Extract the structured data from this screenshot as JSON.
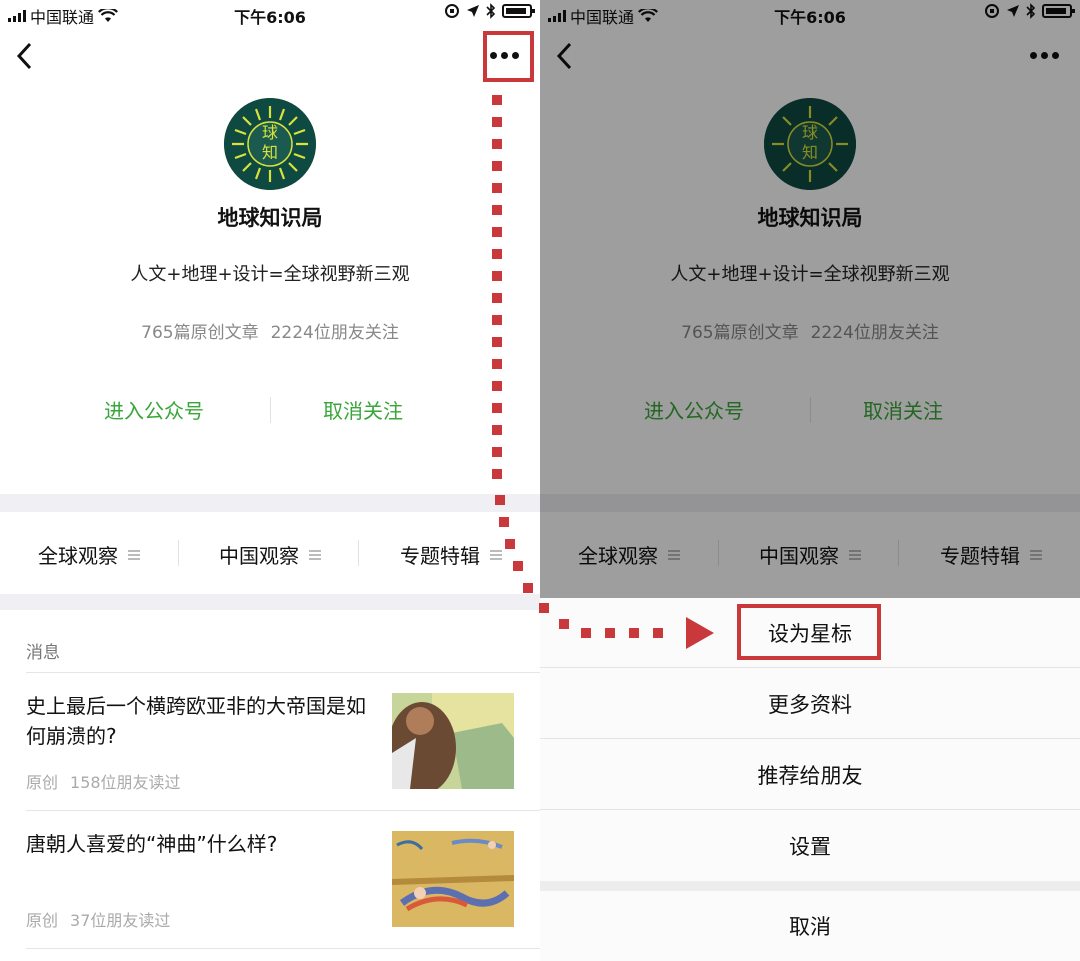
{
  "status_bar": {
    "carrier": "中国联通",
    "time": "下午6:06"
  },
  "profile": {
    "avatar_text": "球知",
    "name": "地球知识局",
    "description": "人文+地理+设计=全球视野新三观",
    "articles": "765篇原创文章",
    "followers": "2224位朋友关注",
    "enter_label": "进入公众号",
    "unfollow_label": "取消关注"
  },
  "menu": [
    {
      "label": "全球观察"
    },
    {
      "label": "中国观察"
    },
    {
      "label": "专题特辑"
    }
  ],
  "messages": {
    "header": "消息",
    "items": [
      {
        "title": "史上最后一个横跨欧亚非的大帝国是如何崩溃的?",
        "tag": "原创",
        "reads": "158位朋友读过"
      },
      {
        "title": "唐朝人喜爱的“神曲”什么样?",
        "tag": "原创",
        "reads": "37位朋友读过"
      }
    ]
  },
  "action_sheet": {
    "items": [
      "设为星标",
      "更多资料",
      "推荐给朋友",
      "设置"
    ],
    "cancel": "取消"
  },
  "colors": {
    "accent_green": "#3aa63a",
    "annotation_red": "#c9383b"
  }
}
